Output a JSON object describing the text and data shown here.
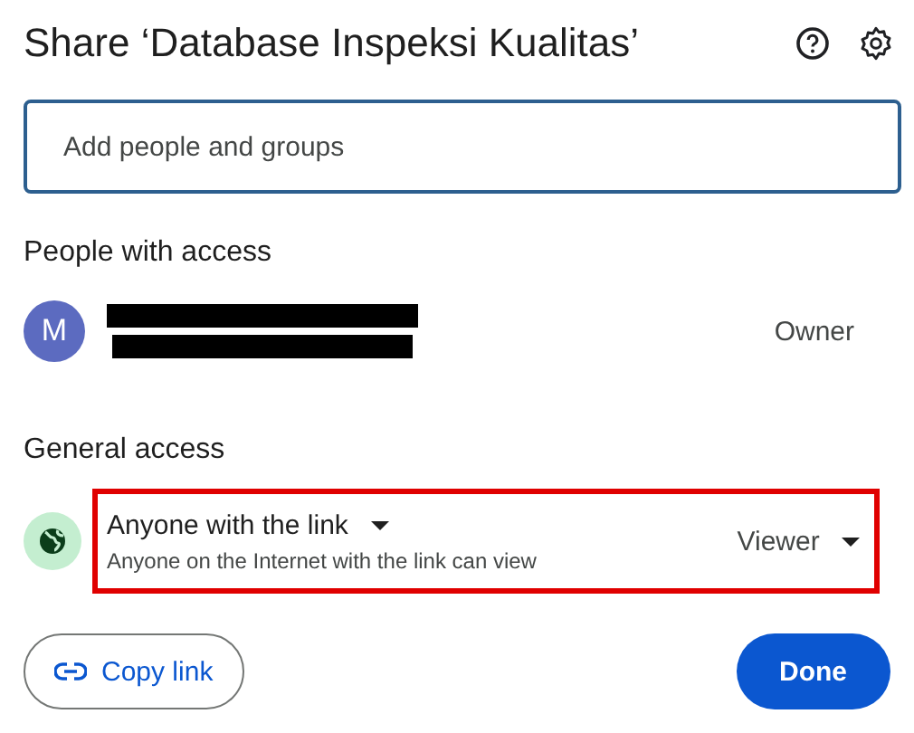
{
  "dialog": {
    "title": "Share ‘Database Inspeksi Kualitas’"
  },
  "add_field": {
    "placeholder": "Add people and groups"
  },
  "people_section": {
    "heading": "People with access",
    "people": [
      {
        "initial": "M",
        "role": "Owner",
        "redacted": true
      }
    ]
  },
  "general_access": {
    "heading": "General access",
    "scope": "Anyone with the link",
    "description": "Anyone on the Internet with the link can view",
    "role": "Viewer",
    "highlighted": true
  },
  "buttons": [
    {
      "label": "Copy link",
      "kind": "outlined"
    },
    {
      "label": "Done",
      "kind": "filled"
    }
  ]
}
